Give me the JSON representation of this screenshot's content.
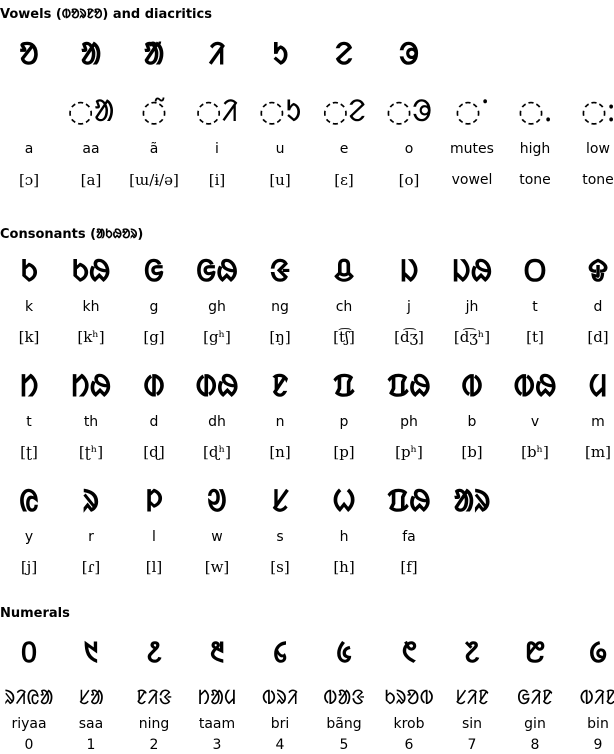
{
  "vowels": {
    "heading": "Vowels (ᱵᱚᱨᱱᱚ) and diacritics",
    "letters": [
      {
        "glyph": "ᱚ",
        "name": "a",
        "ipa": "[ɔ]"
      },
      {
        "glyph": "ᱟ",
        "name": "aa",
        "ipa": "[a]"
      },
      {
        "glyph": "ᱟ̃",
        "name": "ã",
        "ipa": "[ɯ/ɨ/ə]"
      },
      {
        "glyph": "ᱤ",
        "name": "i",
        "ipa": "[i]"
      },
      {
        "glyph": "ᱩ",
        "name": "u",
        "ipa": "[u]"
      },
      {
        "glyph": "ᱮ",
        "name": "e",
        "ipa": "[ɛ]"
      },
      {
        "glyph": "ᱳ",
        "name": "o",
        "ipa": "[o]"
      }
    ],
    "diacritics": [
      "◌ᱟ",
      "◌̃",
      "◌ᱤ",
      "◌ᱩ",
      "◌ᱮ",
      "◌ᱳ"
    ],
    "marks": [
      {
        "glyph": "◌ᱸ",
        "name": "mutes",
        "desc": "vowel"
      },
      {
        "glyph": "◌ᱹ",
        "name": "high",
        "desc": "tone"
      },
      {
        "glyph": "◌ᱺ",
        "name": "low",
        "desc": "tone"
      }
    ]
  },
  "consonants": {
    "heading": "Consonants (ᱟᱠᱷᱚᱨ)",
    "rows": [
      [
        {
          "glyph": "ᱠ",
          "name": "k",
          "ipa": "[k]"
        },
        {
          "glyph": "ᱠᱷ",
          "name": "kh",
          "ipa": "[kʰ]"
        },
        {
          "glyph": "ᱜ",
          "name": "g",
          "ipa": "[g]"
        },
        {
          "glyph": "ᱜᱷ",
          "name": "gh",
          "ipa": "[gʰ]"
        },
        {
          "glyph": "ᱝ",
          "name": "ng",
          "ipa": "[ŋ]"
        },
        {
          "glyph": "ᱪ",
          "name": "ch",
          "ipa": "[t͡ʃ]"
        },
        {
          "glyph": "ᱡ",
          "name": "j",
          "ipa": "[d͡ʒ]"
        },
        {
          "glyph": "ᱡᱷ",
          "name": "jh",
          "ipa": "[d͡ʒʰ]"
        },
        {
          "glyph": "ᱛ",
          "name": "t",
          "ipa": "[t]"
        },
        {
          "glyph": "ᱫ",
          "name": "d",
          "ipa": "[d]"
        }
      ],
      [
        {
          "glyph": "ᱴ",
          "name": "t",
          "ipa": "[ʈ]"
        },
        {
          "glyph": "ᱴᱷ",
          "name": "th",
          "ipa": "[ʈʰ]"
        },
        {
          "glyph": "ᱰ",
          "name": "d",
          "ipa": "[ɖ]"
        },
        {
          "glyph": "ᱰᱷ",
          "name": "dh",
          "ipa": "[ɖʰ]"
        },
        {
          "glyph": "ᱱ",
          "name": "n",
          "ipa": "[n]"
        },
        {
          "glyph": "ᱯ",
          "name": "p",
          "ipa": "[p]"
        },
        {
          "glyph": "ᱯᱷ",
          "name": "ph",
          "ipa": "[pʰ]"
        },
        {
          "glyph": "ᱵ",
          "name": "b",
          "ipa": "[b]"
        },
        {
          "glyph": "ᱵᱷ",
          "name": "v",
          "ipa": "[bʰ]"
        },
        {
          "glyph": "ᱢ",
          "name": "m",
          "ipa": "[m]"
        }
      ],
      [
        {
          "glyph": "ᱭ",
          "name": "y",
          "ipa": "[j]"
        },
        {
          "glyph": "ᱨ",
          "name": "r",
          "ipa": "[ɾ]"
        },
        {
          "glyph": "ᱞ",
          "name": "l",
          "ipa": "[l]"
        },
        {
          "glyph": "ᱣ",
          "name": "w",
          "ipa": "[w]"
        },
        {
          "glyph": "ᱥ",
          "name": "s",
          "ipa": "[s]"
        },
        {
          "glyph": "ᱦ",
          "name": "h",
          "ipa": "[h]"
        },
        {
          "glyph": "ᱯᱷ",
          "name": "fa",
          "ipa": "[f]"
        },
        {
          "glyph": "ᱟᱨ",
          "name": "",
          "ipa": ""
        }
      ]
    ]
  },
  "numerals": {
    "heading": "Numerals",
    "items": [
      {
        "glyph": "᱐",
        "word": "ᱨᱤᱭᱟ",
        "name": "riyaa",
        "digit": "0"
      },
      {
        "glyph": "᱑",
        "word": "ᱥᱟ",
        "name": "saa",
        "digit": "1"
      },
      {
        "glyph": "᱒",
        "word": "ᱱᱤᱝ",
        "name": "ning",
        "digit": "2"
      },
      {
        "glyph": "᱓",
        "word": "ᱴᱟᱢ",
        "name": "taam",
        "digit": "3"
      },
      {
        "glyph": "᱔",
        "word": "ᱵᱨᱤ",
        "name": "bri",
        "digit": "4"
      },
      {
        "glyph": "᱕",
        "word": "ᱵᱟᱝ",
        "name": "bãng",
        "digit": "5"
      },
      {
        "glyph": "᱖",
        "word": "ᱠᱨᱚᱵ",
        "name": "krob",
        "digit": "6"
      },
      {
        "glyph": "᱗",
        "word": "ᱥᱤᱱ",
        "name": "sin",
        "digit": "7"
      },
      {
        "glyph": "᱘",
        "word": "ᱜᱤᱱ",
        "name": "gin",
        "digit": "8"
      },
      {
        "glyph": "᱙",
        "word": "ᱵᱤᱱ",
        "name": "bin",
        "digit": "9"
      }
    ]
  }
}
